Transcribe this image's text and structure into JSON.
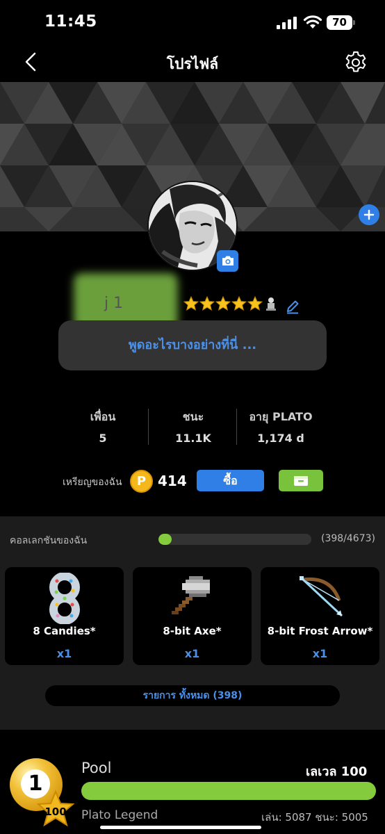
{
  "status_bar": {
    "time": "11:45",
    "battery": "70"
  },
  "nav": {
    "title": "โปรไฟล์"
  },
  "profile": {
    "name": "j 1",
    "say_something": "พูดอะไรบางอย่างที่นี่ ...",
    "star_count": 5
  },
  "stats": [
    {
      "label": "เพื่อน",
      "value": "5"
    },
    {
      "label": "ชนะ",
      "value": "11.1K"
    },
    {
      "label": "อายุ PLATO",
      "value": "1,174 d"
    }
  ],
  "coins": {
    "label": "เหรียญของฉัน",
    "icon_letter": "P",
    "value": "414",
    "buy_label": "ซื้อ"
  },
  "collection": {
    "title": "คอลเลกชันของฉัน",
    "count": "(398/4673)",
    "progress_fraction": 0.085,
    "items": [
      {
        "name": "8 Candies*",
        "qty": "x1",
        "icon": "candy-ring-icon"
      },
      {
        "name": "8-bit Axe*",
        "qty": "x1",
        "icon": "pixel-axe-icon"
      },
      {
        "name": "8-bit Frost Arrow*",
        "qty": "x1",
        "icon": "pixel-bow-icon"
      }
    ],
    "all_items_label": "รายการ ทั้งหมด (398)"
  },
  "game": {
    "ball_number": "1",
    "badge_level": "100",
    "name": "Pool",
    "level": "เลเวล 100",
    "rank": "Plato Legend",
    "plays_wins": "เล่น: 5087 ชนะ: 5005"
  },
  "colors": {
    "accent_blue": "#2f7fe6",
    "accent_green": "#84cc3e",
    "coin_gold": "#f5b81c"
  }
}
